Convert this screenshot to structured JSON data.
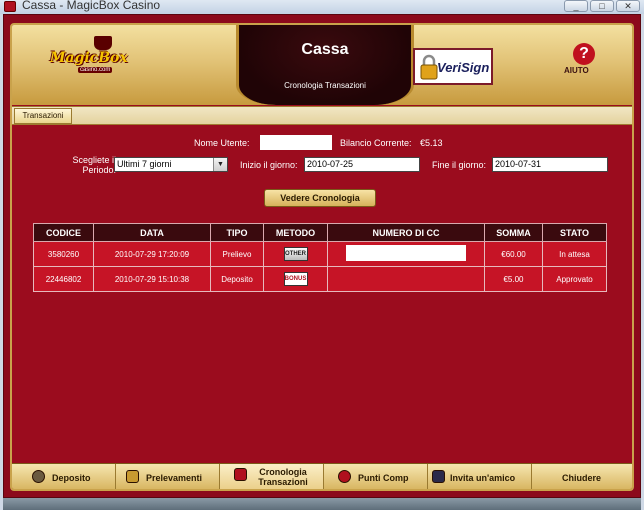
{
  "window": {
    "title": "Cassa - MagicBox Casino",
    "controls": [
      "_",
      "□",
      "✕"
    ]
  },
  "header": {
    "logo_text": "MagicBox",
    "logo_sub": "casino.com",
    "title": "Cassa",
    "subtitle": "Cronologia Transazioni",
    "verisign_label": "VeriSign",
    "help_label": "AIUTO",
    "help_icon": "?"
  },
  "tabs": [
    {
      "label": "Transazioni",
      "active": true
    }
  ],
  "form": {
    "username_label": "Nome Utente:",
    "username_value": "",
    "balance_label": "Bilancio Corrente:",
    "balance_value": "€5.13",
    "period_label": "Scegliete il Periodo:",
    "period_value": "Ultimi 7 giorni",
    "start_label": "Inizio il giorno:",
    "start_value": "2010-07-25",
    "end_label": "Fine il giorno:",
    "end_value": "2010-07-31",
    "view_button": "Vedere Cronologia"
  },
  "table": {
    "headers": [
      "CODICE",
      "DATA",
      "TIPO",
      "METODO",
      "NUMERO DI CC",
      "SOMMA",
      "STATO"
    ],
    "rows": [
      {
        "codice": "3580260",
        "data": "2010-07-29 17:20:09",
        "tipo": "Prelievo",
        "metodo": "OTHER",
        "numero_cc": "",
        "somma": "€60.00",
        "stato": "In attesa"
      },
      {
        "codice": "22446802",
        "data": "2010-07-29 15:10:38",
        "tipo": "Deposito",
        "metodo": "BONUS",
        "numero_cc": "",
        "somma": "€5.00",
        "stato": "Approvato"
      }
    ]
  },
  "footer": {
    "buttons": [
      {
        "label": "Deposito",
        "icon": "deposit-icon"
      },
      {
        "label": "Prelevamenti",
        "icon": "withdraw-icon"
      },
      {
        "label": "Cronologia Transazioni",
        "icon": "history-icon",
        "active": true
      },
      {
        "label": "Punti Comp",
        "icon": "comp-points-icon"
      },
      {
        "label": "Invita un'amico",
        "icon": "invite-friend-icon"
      },
      {
        "label": "Chiudere",
        "icon": ""
      }
    ]
  },
  "colors": {
    "primary_red": "#9b0c1e",
    "header_gold": "#e2c377",
    "table_header": "#3a0a0e",
    "row_red": "#c61426"
  }
}
